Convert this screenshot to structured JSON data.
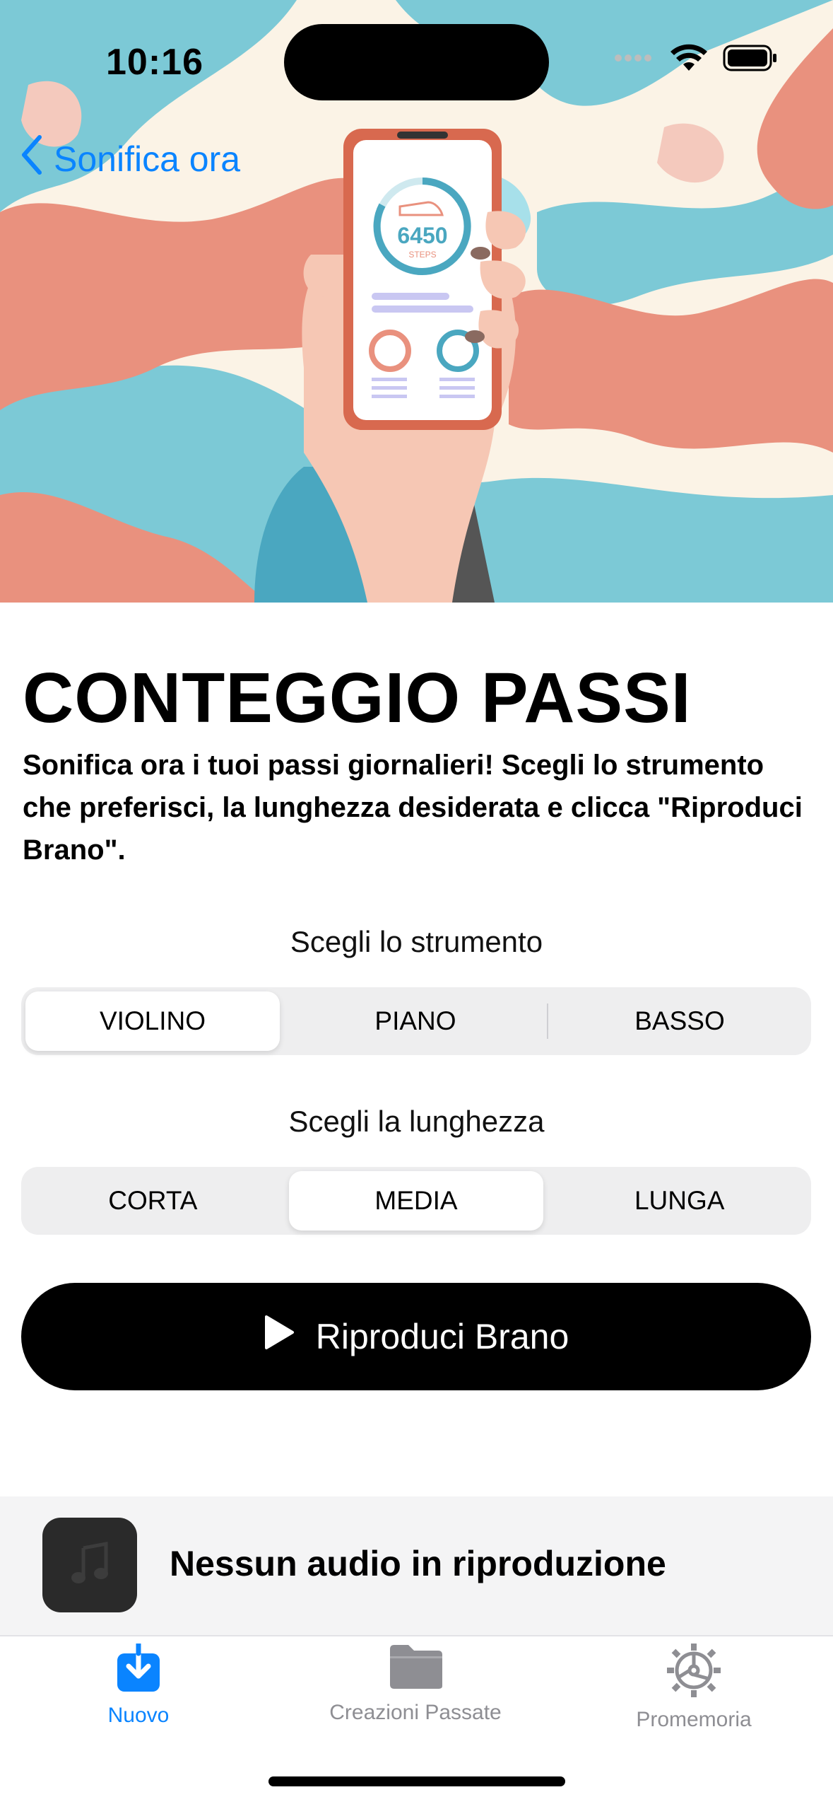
{
  "status_bar": {
    "time": "10:16"
  },
  "nav": {
    "back_label": "Sonifica ora"
  },
  "hero": {
    "phone_steps": "6450",
    "phone_steps_unit": "STEPS"
  },
  "header": {
    "title": "CONTEGGIO PASSI",
    "description": "Sonifica ora i tuoi passi giornalieri! Scegli lo strumento che preferisci, la lunghezza desiderata e clicca \"Riproduci Brano\"."
  },
  "instrument": {
    "label": "Scegli lo strumento",
    "options": [
      "VIOLINO",
      "PIANO",
      "BASSO"
    ],
    "selected": "VIOLINO"
  },
  "length": {
    "label": "Scegli la lunghezza",
    "options": [
      "CORTA",
      "MEDIA",
      "LUNGA"
    ],
    "selected": "MEDIA"
  },
  "play_button": {
    "label": "Riproduci Brano"
  },
  "now_playing": {
    "text": "Nessun audio in riproduzione"
  },
  "tabs": [
    {
      "label": "Nuovo",
      "icon": "download-tray-icon",
      "active": true
    },
    {
      "label": "Creazioni Passate",
      "icon": "folder-icon",
      "active": false
    },
    {
      "label": "Promemoria",
      "icon": "gear-icon",
      "active": false
    }
  ],
  "colors": {
    "accent": "#0a84ff",
    "inactive_tab": "#8e8e93",
    "hero_teal": "#7cc9d6",
    "hero_salmon": "#e9917e",
    "hero_cream": "#fbf3e6"
  }
}
